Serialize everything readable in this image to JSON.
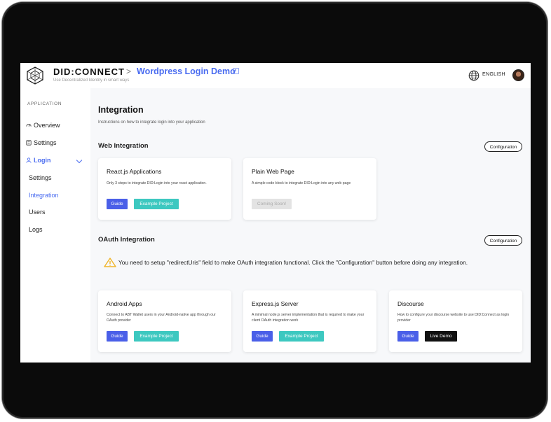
{
  "header": {
    "brand": "DID:CONNECT",
    "separator": ">",
    "app_title": "Wordpress Login Demo",
    "tagline": "Use Decentralized Identity in smart ways",
    "language": "ENGLISH",
    "icons": {
      "logo": "did-connect-logo",
      "edit": "edit-icon",
      "globe": "globe-icon",
      "avatar": "user-avatar"
    }
  },
  "sidebar": {
    "section_label": "APPLICATION",
    "items": [
      {
        "label": "Overview",
        "icon": "dashboard-icon"
      },
      {
        "label": "Settings",
        "icon": "settings-icon"
      },
      {
        "label": "Login",
        "icon": "user-icon",
        "active": true
      }
    ],
    "login_sub_items": [
      {
        "label": "Settings"
      },
      {
        "label": "Integration",
        "active": true
      },
      {
        "label": "Users"
      },
      {
        "label": "Logs"
      }
    ]
  },
  "main": {
    "title": "Integration",
    "subtitle": "Instructions on how to integrate login into your application",
    "web_integration": {
      "title": "Web Integration",
      "config_label": "Configuration",
      "cards": [
        {
          "title": "React.js Applications",
          "desc": "Only 3 steps to integrate DID:Login into your react application.",
          "guide": "Guide",
          "example": "Example Project"
        },
        {
          "title": "Plain Web Page",
          "desc": "A simple code block to integrate DID:Login into any web page",
          "coming": "Coming Soon!"
        }
      ]
    },
    "oauth_integration": {
      "title": "OAuth Integration",
      "config_label": "Configuration",
      "warning": "You need to setup \"redirectUris\" field to make OAuth integration functional. Click the \"Configuration\" button before doing any integration.",
      "cards": [
        {
          "title": "Android Apps",
          "desc": "Connect to ABT Wallet users in your Android-native app through our OAuth provider",
          "guide": "Guide",
          "example": "Example Project"
        },
        {
          "title": "Express.js Server",
          "desc": "A minimal node.js server implementation that is required to make your client OAuth integration work",
          "guide": "Guide",
          "example": "Example Project"
        },
        {
          "title": "Discourse",
          "desc": "How to configure your discourse website to use DID:Connect as login provider",
          "guide": "Guide",
          "demo": "Live Demo"
        }
      ]
    }
  },
  "colors": {
    "accent": "#4a6cf0",
    "guide_button": "#4a5fe8",
    "example_button": "#3dc8c0",
    "warning": "#f0b429",
    "bezel": "#0b0b0b"
  }
}
